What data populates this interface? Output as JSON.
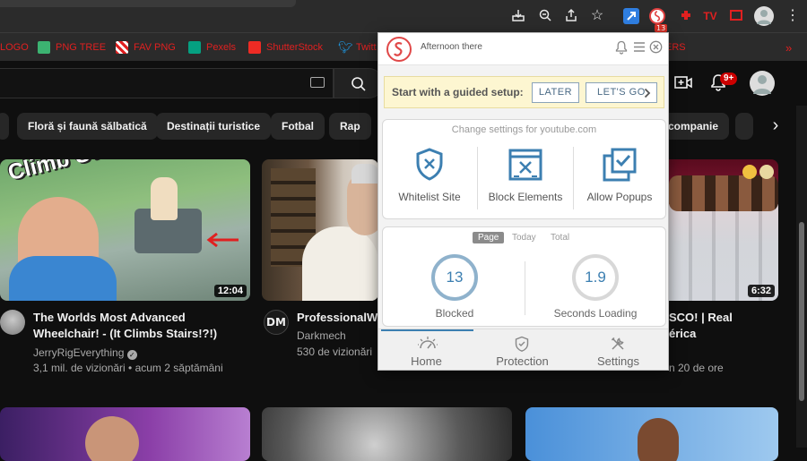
{
  "browser": {
    "extension_badge": "13"
  },
  "bookmarks": [
    {
      "label": "LOGO",
      "icon": "bookmark-icon-red"
    },
    {
      "label": "PNG TREE",
      "icon": "pngtree-icon"
    },
    {
      "label": "FAV PNG",
      "icon": "favpng-icon"
    },
    {
      "label": "Pexels",
      "icon": "pexels-icon"
    },
    {
      "label": "ShutterStock",
      "icon": "shutterstock-icon"
    },
    {
      "label": "Twitt",
      "icon": "twitter-icon"
    },
    {
      "label": "ERS",
      "icon": "folder-icon"
    }
  ],
  "youtube": {
    "notification_count": "9+",
    "chips": [
      "Floră și faună sălbatică",
      "Destinații turistice",
      "Fotbal",
      "Rap",
      "companie"
    ],
    "videos": [
      {
        "thumb_text": "Climb Stairs?",
        "duration": "12:04",
        "title_line1": "The Worlds Most Advanced",
        "title_line2": "Wheelchair! - (It Climbs Stairs!?!)",
        "channel": "JerryRigEverything",
        "stats": "3,1 mil. de vizionări • acum 2 săptămâni"
      },
      {
        "thumb_text": "",
        "duration": "",
        "title_line1": "ProfessionalWO",
        "title_line2": "",
        "channel": "Darkmech",
        "channel_avatar_text": "DM",
        "stats": "530 de vizionări"
      },
      {
        "duration": "6:32",
        "title_line1": "SCO! | Real",
        "title_line2": "érica",
        "stats": "n 20 de ore"
      }
    ]
  },
  "popup": {
    "greeting": "Afternoon there",
    "setup_prompt": "Start with a guided setup:",
    "later_button": "LATER",
    "lets_go_button": "LET'S GO",
    "site_hint": "Change settings for youtube.com",
    "actions": [
      "Whitelist Site",
      "Block Elements",
      "Allow Popups"
    ],
    "stat_tabs": [
      "Page",
      "Today",
      "Total"
    ],
    "blocked_value": "13",
    "blocked_label": "Blocked",
    "loading_value": "1.9",
    "loading_label": "Seconds Loading",
    "nav": [
      "Home",
      "Protection",
      "Settings"
    ],
    "accent_color": "#3c7fb1"
  }
}
